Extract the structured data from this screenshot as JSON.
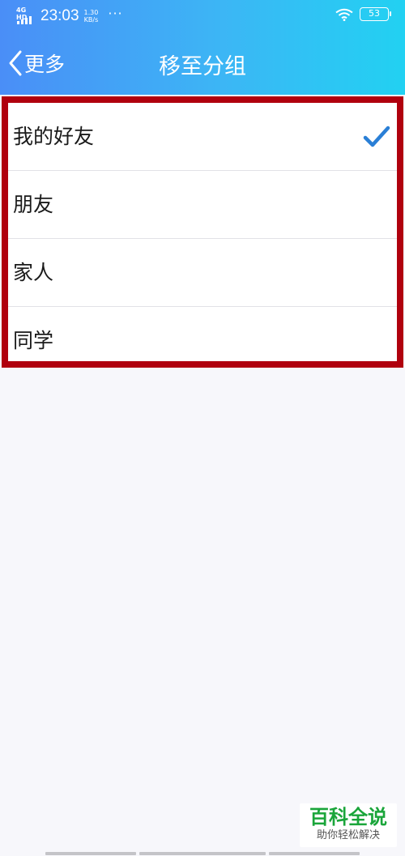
{
  "status_bar": {
    "network": "4G HD",
    "time": "23:03",
    "speed_value": "1.30",
    "speed_unit": "KB/s",
    "more": "···",
    "battery": "53"
  },
  "header": {
    "back_label": "更多",
    "title": "移至分组"
  },
  "groups": [
    {
      "label": "我的好友",
      "selected": true
    },
    {
      "label": "朋友",
      "selected": false
    },
    {
      "label": "家人",
      "selected": false
    },
    {
      "label": "同学",
      "selected": false
    }
  ],
  "watermark": {
    "title": "百科全说",
    "subtitle": "助你轻松解决"
  },
  "colors": {
    "header_start": "#4a8ef7",
    "header_end": "#22d1f2",
    "highlight_border": "#b0000e",
    "check": "#2a7fd6",
    "watermark_green": "#1aa53a"
  }
}
